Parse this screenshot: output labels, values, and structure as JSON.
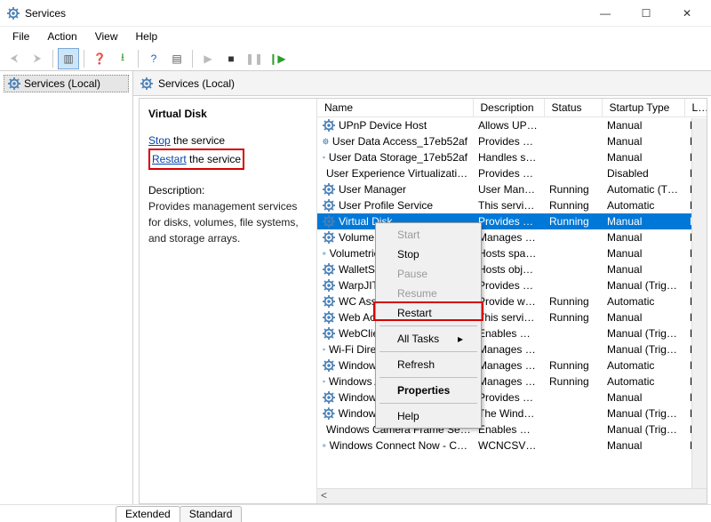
{
  "window": {
    "title": "Services"
  },
  "menubar": [
    "File",
    "Action",
    "View",
    "Help"
  ],
  "left_tree": {
    "root": "Services (Local)"
  },
  "pane_header": "Services (Local)",
  "detail": {
    "name": "Virtual Disk",
    "link_stop": "Stop",
    "link_stop_tail": " the service",
    "link_restart": "Restart",
    "link_restart_tail": " the service",
    "desc_label": "Description:",
    "desc_text": "Provides management services for disks, volumes, file systems, and storage arrays."
  },
  "columns": {
    "name": "Name",
    "description": "Description",
    "status": "Status",
    "startup": "Startup Type",
    "logon": "Log On As"
  },
  "rows": [
    {
      "n": "UPnP Device Host",
      "d": "Allows UPn…",
      "s": "",
      "t": "Manual",
      "l": "Loca"
    },
    {
      "n": "User Data Access_17eb52af",
      "d": "Provides ap…",
      "s": "",
      "t": "Manual",
      "l": "Loca"
    },
    {
      "n": "User Data Storage_17eb52af",
      "d": "Handles sto…",
      "s": "",
      "t": "Manual",
      "l": "Loca"
    },
    {
      "n": "User Experience Virtualizati…",
      "d": "Provides su…",
      "s": "",
      "t": "Disabled",
      "l": "Loca"
    },
    {
      "n": "User Manager",
      "d": "User Manag…",
      "s": "Running",
      "t": "Automatic (T…",
      "l": "Loca"
    },
    {
      "n": "User Profile Service",
      "d": "This service …",
      "s": "Running",
      "t": "Automatic",
      "l": "Loca"
    },
    {
      "n": "Virtual Disk",
      "d": "Provides m…",
      "s": "Running",
      "t": "Manual",
      "l": "Loca",
      "sel": true
    },
    {
      "n": "Volume Shadow Copy",
      "d": "Manages an…",
      "s": "",
      "t": "Manual",
      "l": "Loca"
    },
    {
      "n": "Volumetric Audio Composit…",
      "d": "Hosts spatia…",
      "s": "",
      "t": "Manual",
      "l": "Loca"
    },
    {
      "n": "WalletService",
      "d": "Hosts objec…",
      "s": "",
      "t": "Manual",
      "l": "Loca"
    },
    {
      "n": "WarpJITSvc",
      "d": "Provides a JI…",
      "s": "",
      "t": "Manual (Trig…",
      "l": "Loca"
    },
    {
      "n": "WC Assistant",
      "d": "Provide ware …",
      "s": "Running",
      "t": "Automatic",
      "l": "Loca"
    },
    {
      "n": "Web Account Manager",
      "d": "This service …",
      "s": "Running",
      "t": "Manual",
      "l": "Loca"
    },
    {
      "n": "WebClient",
      "d": "Enables Win…",
      "s": "",
      "t": "Manual (Trig…",
      "l": "Loca"
    },
    {
      "n": "Wi-Fi Direct Services Conn…",
      "d": "Manages co…",
      "s": "",
      "t": "Manual (Trig…",
      "l": "Loca"
    },
    {
      "n": "Windows Audio",
      "d": "Manages au…",
      "s": "Running",
      "t": "Automatic",
      "l": "Loca"
    },
    {
      "n": "Windows Audio Endpoint B…",
      "d": "Manages au…",
      "s": "Running",
      "t": "Automatic",
      "l": "Loca"
    },
    {
      "n": "Windows Backup",
      "d": "Provides Wi…",
      "s": "",
      "t": "Manual",
      "l": "Loca"
    },
    {
      "n": "Windows Biometric Service",
      "d": "The Windo…",
      "s": "",
      "t": "Manual (Trig…",
      "l": "Loca"
    },
    {
      "n": "Windows Camera Frame Se…",
      "d": "Enables mul…",
      "s": "",
      "t": "Manual (Trig…",
      "l": "Loca"
    },
    {
      "n": "Windows Connect Now - C…",
      "d": "WCNCSVC …",
      "s": "",
      "t": "Manual",
      "l": "Loca"
    }
  ],
  "tabs": {
    "extended": "Extended",
    "standard": "Standard"
  },
  "context_menu": {
    "start": "Start",
    "stop": "Stop",
    "pause": "Pause",
    "resume": "Resume",
    "restart": "Restart",
    "all_tasks": "All Tasks",
    "refresh": "Refresh",
    "properties": "Properties",
    "help": "Help"
  }
}
